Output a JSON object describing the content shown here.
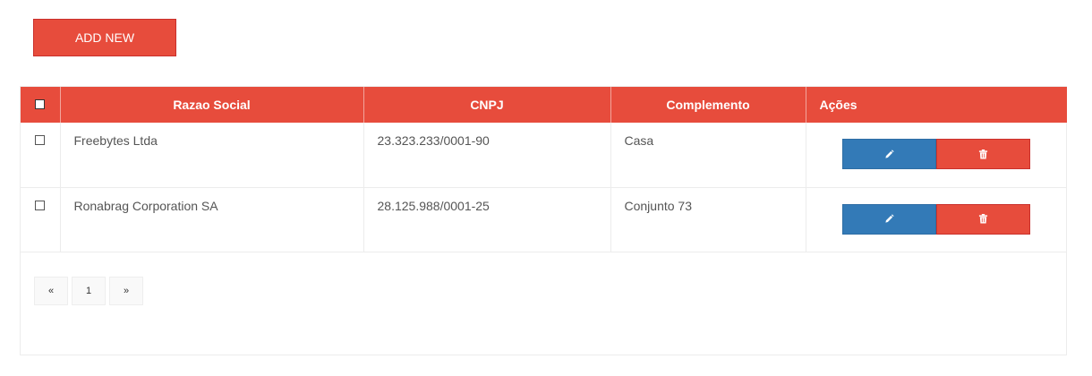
{
  "toolbar": {
    "add_new_label": "ADD NEW"
  },
  "table": {
    "headers": [
      "Razao Social",
      "CNPJ",
      "Complemento",
      "Ações"
    ],
    "rows": [
      {
        "razao_social": "Freebytes Ltda",
        "cnpj": "23.323.233/0001-90",
        "complemento": "Casa"
      },
      {
        "razao_social": "Ronabrag Corporation SA",
        "cnpj": "28.125.988/0001-25",
        "complemento": "Conjunto 73"
      }
    ]
  },
  "pagination": {
    "prev": "«",
    "current": "1",
    "next": "»"
  },
  "icons": {
    "edit": "pencil-icon",
    "delete": "trash-icon"
  },
  "colors": {
    "accent": "#e74c3c",
    "primary": "#337ab7"
  }
}
